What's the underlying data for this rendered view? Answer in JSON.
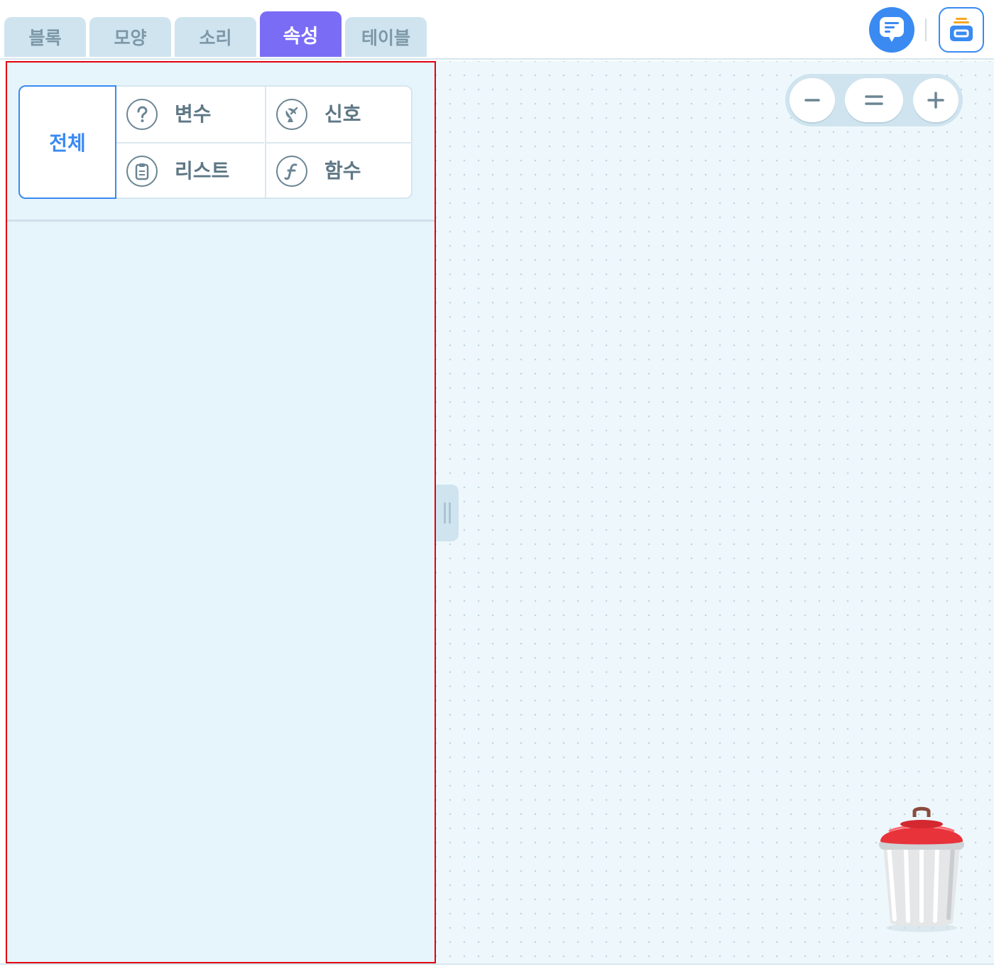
{
  "tabs": [
    {
      "label": "블록",
      "active": false
    },
    {
      "label": "모양",
      "active": false
    },
    {
      "label": "소리",
      "active": false
    },
    {
      "label": "속성",
      "active": true
    },
    {
      "label": "테이블",
      "active": false
    }
  ],
  "toolbar": {
    "message_icon": "chat-message-icon",
    "storage_icon": "storage-box-icon"
  },
  "categories": {
    "all": "전체",
    "items": [
      {
        "label": "변수",
        "icon": "question-icon"
      },
      {
        "label": "신호",
        "icon": "satellite-dish-icon"
      },
      {
        "label": "리스트",
        "icon": "clipboard-list-icon"
      },
      {
        "label": "함수",
        "icon": "function-icon"
      }
    ]
  },
  "zoom": {
    "out_icon": "minus-icon",
    "reset_icon": "equals-icon",
    "in_icon": "plus-icon"
  },
  "colors": {
    "accent": "#3a8af2",
    "active_tab": "#7b6cf6",
    "tab_bg": "#cfe4ef",
    "palette_bg": "#e6f5fc",
    "highlight_border": "#e3000f",
    "trash_lid": "#e8333b"
  }
}
